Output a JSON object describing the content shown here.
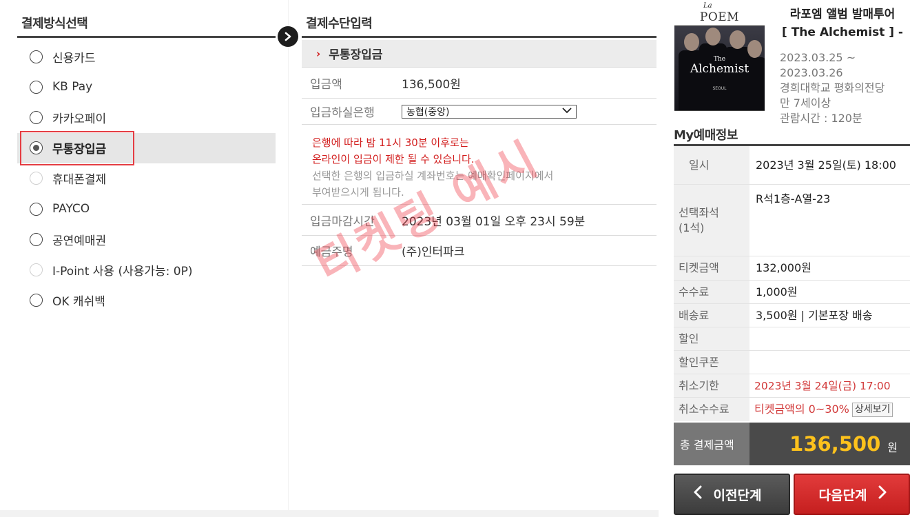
{
  "left_panel": {
    "title": "결제방식선택",
    "methods": [
      {
        "label": "신용카드"
      },
      {
        "label": "KB Pay"
      },
      {
        "label": "카카오페이"
      },
      {
        "label": "무통장입금"
      },
      {
        "label": "휴대폰결제"
      },
      {
        "label": "PAYCO"
      },
      {
        "label": "공연예매권"
      },
      {
        "label": "I-Point 사용 (사용가능: 0P)"
      },
      {
        "label": "OK 캐쉬백"
      }
    ],
    "selected_method": "무통장입금",
    "disabled_methods": [
      "휴대폰결제",
      "I-Point 사용 (사용가능: 0P)"
    ]
  },
  "middle_panel": {
    "title": "결제수단입력",
    "sub_title": "무통장입금",
    "deposit_amount_label": "입금액",
    "deposit_amount_value": "136,500원",
    "bank_label": "입금하실은행",
    "bank_value": "농협(중앙)",
    "notice_red_1": "은행에 따라 밤 11시 30분 이후로는",
    "notice_red_2": "온라인이 입금이 제한 될 수 있습니다.",
    "notice_gray_1": "선택한 은행의 입금하실 계좌번호는 예매확인페이지에서",
    "notice_gray_2": "부여받으시게 됩니다.",
    "deadline_label": "입금마감시간",
    "deadline_value": "2023년 03월 01일 오후 23시 59분",
    "holder_label": "예금주명",
    "holder_value": "(주)인터파크",
    "watermark": "티켓팅 예시"
  },
  "right_panel": {
    "poster_logo_small": "La",
    "poster_logo": "POEM",
    "poster_title": "The",
    "poster_title_2": "Alchemist",
    "poster_sub": "SEOUL",
    "show_name_1": "라포엠 앨범 발매투어",
    "show_name_2": "[ The Alchemist ] -",
    "date_range_1": "2023.03.25 ~",
    "date_range_2": "2023.03.26",
    "venue": "경희대학교 평화의전당",
    "age": "만 7세이상",
    "runtime": "관람시간 : 120분",
    "my_title": "My예매정보",
    "rows": {
      "datetime_label": "일시",
      "datetime_value": "2023년 3월 25일(토) 18:00",
      "seat_label_1": "선택좌석",
      "seat_label_2": "(1석)",
      "seat_value": "R석1층-A열-23",
      "ticket_label": "티켓금액",
      "ticket_value": "132,000원",
      "fee_label": "수수료",
      "fee_value": "1,000원",
      "delivery_label": "배송료",
      "delivery_value": "3,500원 | 기본포장 배송",
      "discount_label": "할인",
      "coupon_label": "할인쿠폰",
      "cancel_deadline_label": "취소기한",
      "cancel_deadline_value": "2023년 3월 24일(금) 17:00",
      "cancel_fee_label": "취소수수료",
      "cancel_fee_value": "티켓금액의 0~30%",
      "detail_button": "상세보기"
    },
    "total_label": "총 결제금액",
    "total_amount": "136,500",
    "total_unit": "원",
    "prev_button": "이전단계",
    "next_button": "다음단계"
  },
  "colors": {
    "accent_red": "#d21d1d",
    "highlight_box": "#e53d43",
    "total_amount": "#fdc21c"
  }
}
